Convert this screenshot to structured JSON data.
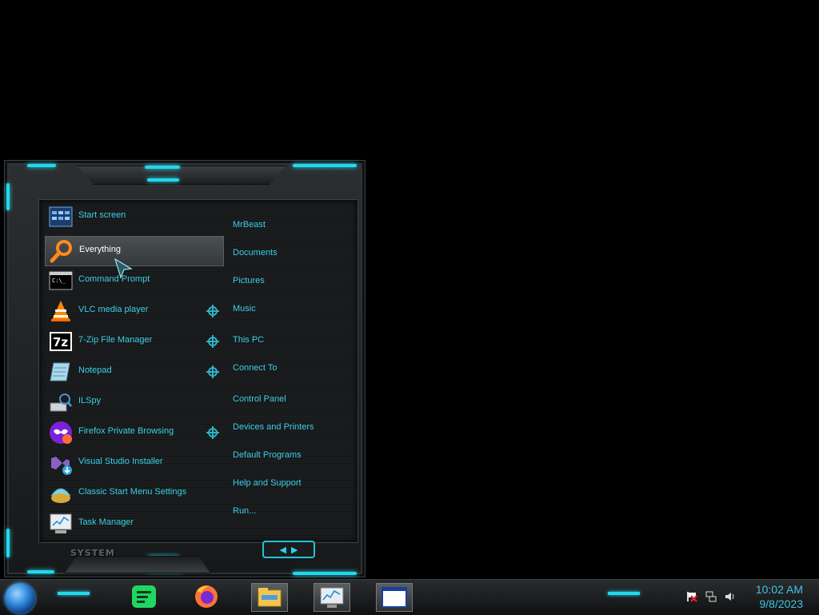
{
  "start_menu": {
    "programs": [
      {
        "label": "Start screen",
        "icon": "start-screen-icon",
        "pinned": false
      },
      {
        "label": "Everything",
        "icon": "everything-search-icon",
        "pinned": false,
        "selected": true
      },
      {
        "label": "Command Prompt",
        "icon": "command-prompt-icon",
        "pinned": false
      },
      {
        "label": "VLC media player",
        "icon": "vlc-icon",
        "pinned": true
      },
      {
        "label": "7-Zip File Manager",
        "icon": "7zip-icon",
        "pinned": true
      },
      {
        "label": "Notepad",
        "icon": "notepad-icon",
        "pinned": true
      },
      {
        "label": "ILSpy",
        "icon": "ilspy-icon",
        "pinned": false
      },
      {
        "label": "Firefox Private Browsing",
        "icon": "firefox-private-icon",
        "pinned": true
      },
      {
        "label": "Visual Studio Installer",
        "icon": "visual-studio-installer-icon",
        "pinned": false
      },
      {
        "label": "Classic Start Menu Settings",
        "icon": "classic-start-settings-icon",
        "pinned": false
      },
      {
        "label": "Task Manager",
        "icon": "task-manager-icon",
        "pinned": false
      }
    ],
    "places": [
      "MrBeast",
      "Documents",
      "Pictures",
      "Music",
      "This PC",
      "Connect To",
      "Control Panel",
      "Devices and Printers",
      "Default Programs",
      "Help and Support",
      "Run..."
    ],
    "system_label": "SYSTEM",
    "expand_arrows": "< >"
  },
  "taskbar": {
    "apps": [
      "spotify-icon",
      "firefox-icon",
      "file-explorer-icon",
      "resource-monitor-icon",
      "window-icon"
    ],
    "tray": [
      "flag-icon",
      "network-icon",
      "volume-icon"
    ],
    "time": "10:02 AM",
    "date": "9/8/2023"
  },
  "colors": {
    "accent": "#23d7ec",
    "text": "#3ad0e8"
  }
}
